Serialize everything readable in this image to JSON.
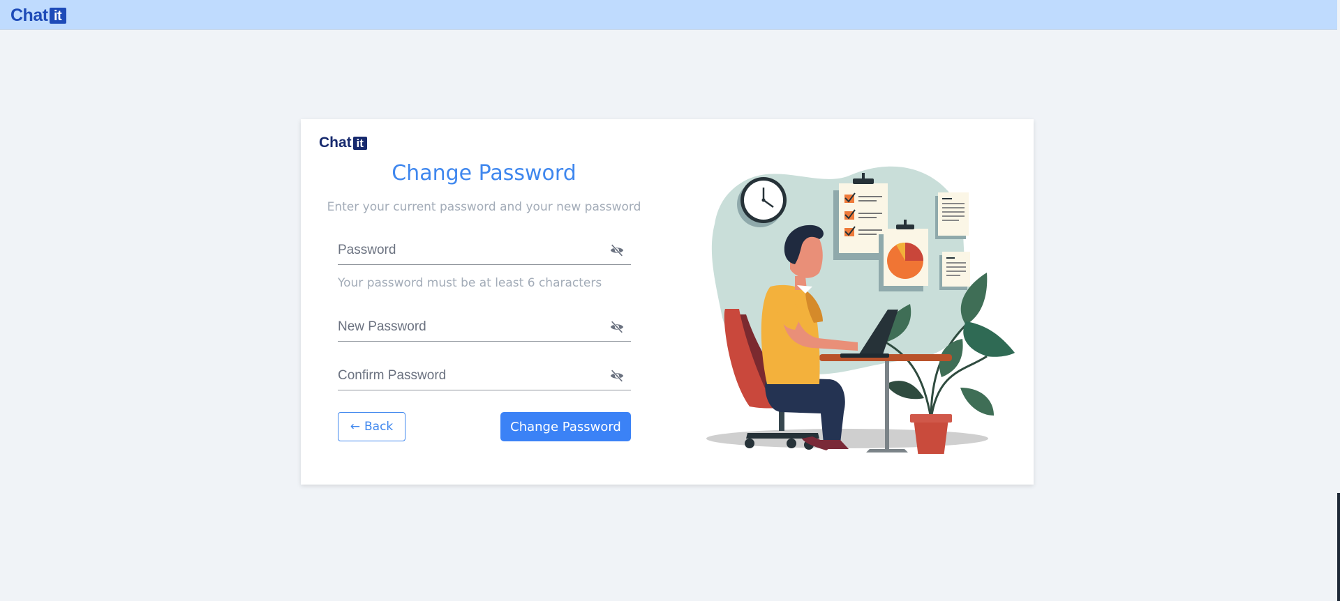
{
  "header": {
    "logo_text": "Chat",
    "logo_badge": "it"
  },
  "card": {
    "logo_text": "Chat",
    "logo_badge": "it",
    "title": "Change Password",
    "subtitle": "Enter your current password and your new password",
    "fields": [
      {
        "placeholder": "Password",
        "value": "",
        "icon": "eye-off-icon"
      },
      {
        "placeholder": "New Password",
        "value": "",
        "icon": "eye-off-icon"
      },
      {
        "placeholder": "Confirm Password",
        "value": "",
        "icon": "eye-off-icon"
      }
    ],
    "password_hint": "Your password must be at least 6 characters",
    "back_label": "Back",
    "back_icon": "arrow-left-icon",
    "submit_label": "Change Password"
  },
  "colors": {
    "topbar": "#bfdbfe",
    "brand": "#1e4bb8",
    "accent": "#3b82f6",
    "muted_text": "#a3acb8",
    "page_bg": "#f0f3f7"
  },
  "illustration": "person-at-desk-with-laptop-illustration"
}
